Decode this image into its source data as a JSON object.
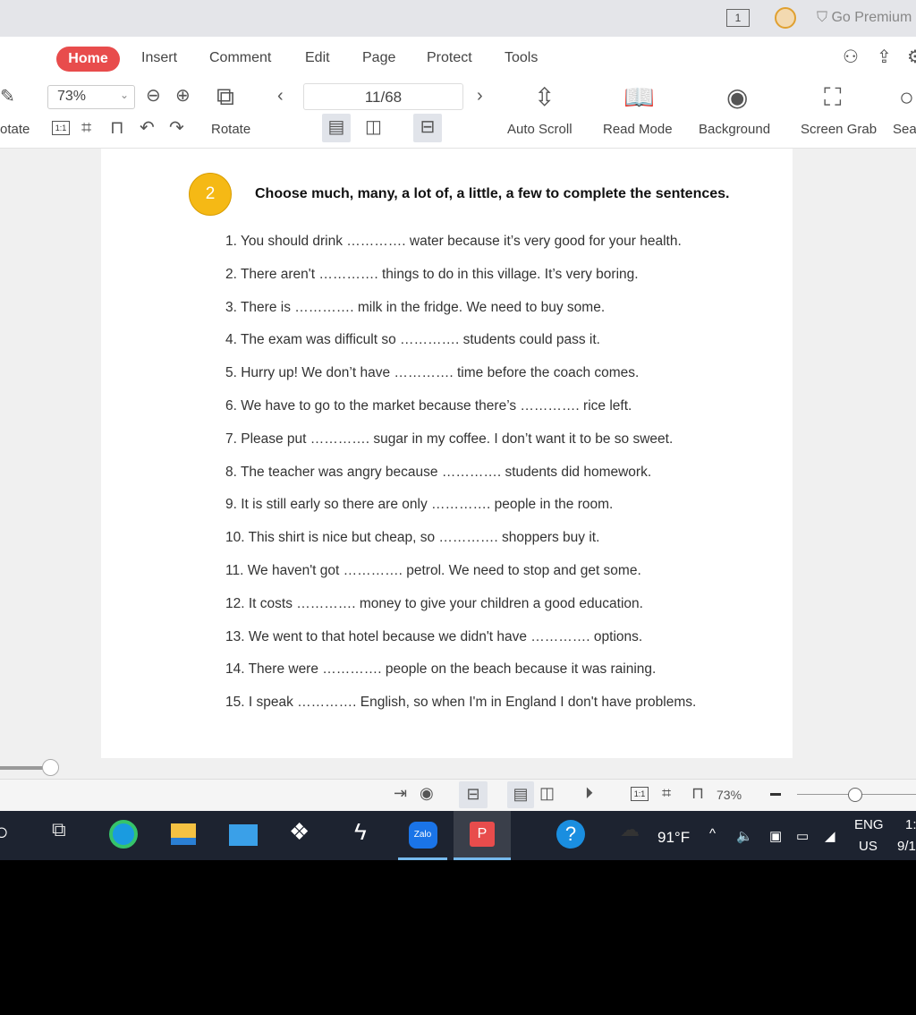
{
  "titlebar": {
    "page_count_icon": "1",
    "go_premium": "Go Premium"
  },
  "tabs": [
    "Home",
    "Insert",
    "Comment",
    "Edit",
    "Page",
    "Protect",
    "Tools"
  ],
  "toolbar": {
    "rotate_left_partial": "otate",
    "zoom": "73%",
    "rotate": "Rotate",
    "page": "11/68",
    "auto_scroll": "Auto Scroll",
    "read_mode": "Read Mode",
    "background": "Background",
    "screen_grab": "Screen Grab",
    "search_partial": "Sea",
    "actual_size": "1:1"
  },
  "document": {
    "exercise_number": "2",
    "instruction": "Choose much, many, a lot of, a little, a few to complete the sentences.",
    "sentences": [
      "1. You should drink …………. water because it’s very good for your health.",
      "2. There aren't …………. things to do in this village. It’s very boring.",
      "3. There is …………. milk in the fridge. We need to buy some.",
      "4. The exam was difficult so …………. students could pass it.",
      "5. Hurry up! We don’t have …………. time before the coach comes.",
      "6. We have to go to the market because there’s …………. rice left.",
      "7. Please put …………. sugar in my coffee. I don’t want it to be so sweet.",
      "8. The teacher was angry because …………. students did homework.",
      "9. It is still early so there are only …………. people in the room.",
      "10. This shirt is nice but cheap, so …………. shoppers buy it.",
      "11. We haven't got …………. petrol. We need to stop and get some.",
      "12. It costs …………. money to give your children a good education.",
      "13. We went to that hotel because we didn't have …………. options.",
      "14. There were …………. people on the beach because it was raining.",
      "15. I speak …………. English, so when I'm in England I don't have problems."
    ]
  },
  "statusbar": {
    "zoom": "73%",
    "actual_size": "1:1"
  },
  "taskbar": {
    "zalo": "Zalo",
    "weather": "91°F",
    "lang1": "ENG",
    "lang2": "US",
    "time_partial": "1:",
    "date_partial": "9/1"
  },
  "colors": {
    "accent": "#e84c4c",
    "badge": "#f5b915"
  }
}
